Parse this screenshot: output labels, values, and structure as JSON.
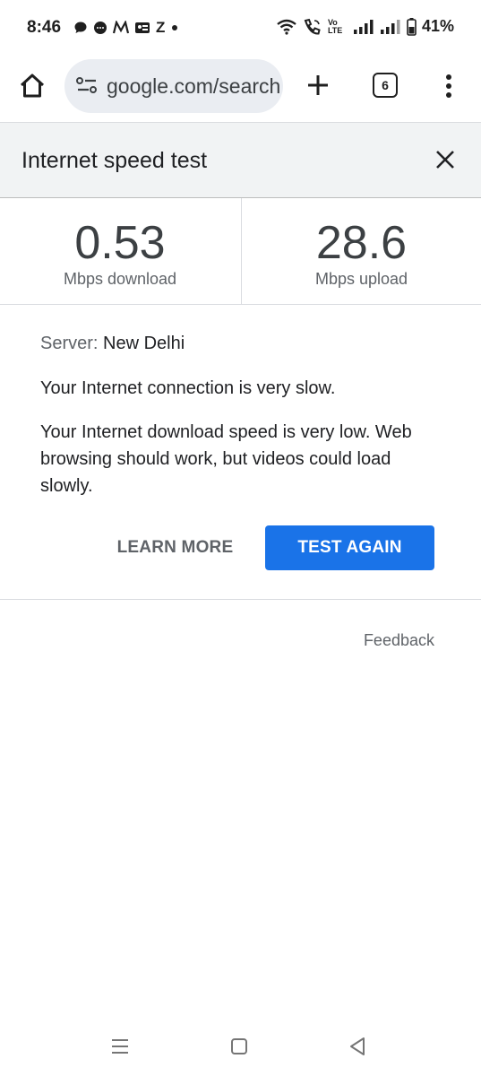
{
  "status_bar": {
    "time": "8:46",
    "left_icons": [
      "chat-bubble-icon",
      "messenger-icon",
      "myntra-icon",
      "app-icon",
      "zomato-icon",
      "dot-icon"
    ],
    "notification_letter": "Z",
    "volte_label": "Vo LTE",
    "battery_percent": "41%"
  },
  "browser": {
    "url": "google.com/search",
    "tab_count": "6"
  },
  "speed_test": {
    "title": "Internet speed test",
    "download": {
      "value": "0.53",
      "label": "Mbps download"
    },
    "upload": {
      "value": "28.6",
      "label": "Mbps upload"
    },
    "server_label": "Server:",
    "server_value": "New Delhi",
    "summary": "Your Internet connection is very slow.",
    "description": "Your Internet download speed is very low. Web browsing should work, but videos could load slowly.",
    "learn_more_label": "LEARN MORE",
    "test_again_label": "TEST AGAIN",
    "feedback_label": "Feedback"
  },
  "colors": {
    "accent": "#1a73e8",
    "header_bg": "#f1f3f4",
    "omnibox_bg": "#eaedf2"
  }
}
